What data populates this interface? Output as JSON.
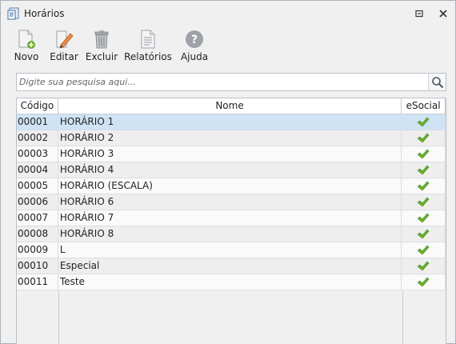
{
  "window": {
    "title": "Horários",
    "icon": "schedule-app-icon"
  },
  "toolbar": {
    "novo": "Novo",
    "editar": "Editar",
    "excluir": "Excluir",
    "relatorios": "Relatórios",
    "ajuda": "Ajuda"
  },
  "search": {
    "placeholder": "Digite sua pesquisa aqui..."
  },
  "grid": {
    "columns": [
      "Código",
      "Nome",
      "eSocial"
    ],
    "rows": [
      {
        "codigo": "00001",
        "nome": "HORÁRIO 1",
        "esocial": true
      },
      {
        "codigo": "00002",
        "nome": "HORÁRIO 2",
        "esocial": true
      },
      {
        "codigo": "00003",
        "nome": "HORÁRIO 3",
        "esocial": true
      },
      {
        "codigo": "00004",
        "nome": "HORÁRIO 4",
        "esocial": true
      },
      {
        "codigo": "00005",
        "nome": "HORÁRIO (ESCALA)",
        "esocial": true
      },
      {
        "codigo": "00006",
        "nome": "HORÁRIO 6",
        "esocial": true
      },
      {
        "codigo": "00007",
        "nome": "HORÁRIO 7",
        "esocial": true
      },
      {
        "codigo": "00008",
        "nome": "HORÁRIO 8",
        "esocial": true
      },
      {
        "codigo": "00009",
        "nome": "L",
        "esocial": true
      },
      {
        "codigo": "00010",
        "nome": "Especial",
        "esocial": true
      },
      {
        "codigo": "00011",
        "nome": "Teste",
        "esocial": true
      }
    ],
    "selected_index": 0
  },
  "colors": {
    "selected_row": "#cfe3f5",
    "check": "#6ab12f"
  }
}
